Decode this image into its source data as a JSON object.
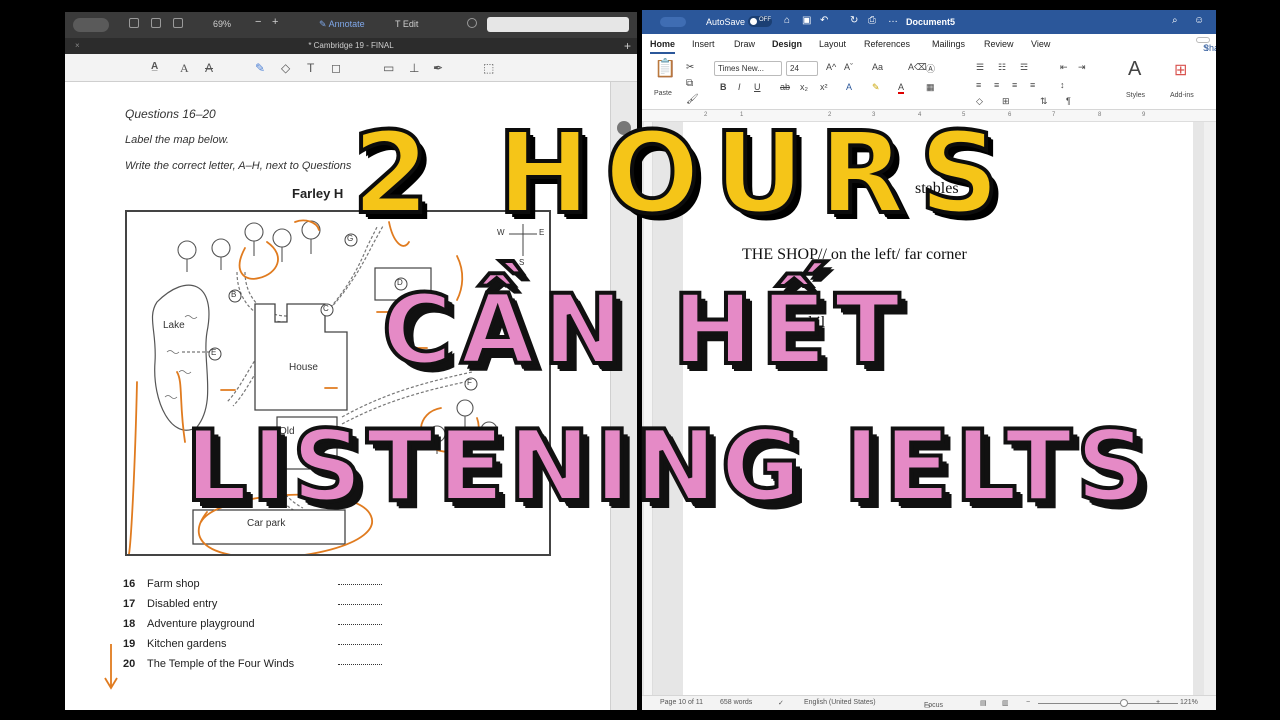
{
  "pdf_viewer": {
    "zoom": "69%",
    "annotate_label": "Annotate",
    "edit_label": "Edit",
    "document_tab": "* Cambridge 19 - FINAL",
    "close_tab": "×",
    "new_tab": "+"
  },
  "pdf_page": {
    "questions_title": "Questions 16–20",
    "instruction_1": "Label the map below.",
    "instruction_2": "Write the correct letter, A–H, next to Questions",
    "map_title": "Farley H",
    "map_labels": {
      "lake": "Lake",
      "house": "House",
      "car_park": "Car park",
      "old": "Old",
      "b": "B",
      "c": "C",
      "d": "D",
      "e": "E",
      "f": "F",
      "g": "G",
      "compass_w": "W",
      "compass_e": "E",
      "compass_s": "S"
    },
    "answers": [
      {
        "num": "16",
        "label": "Farm shop"
      },
      {
        "num": "17",
        "label": "Disabled entry"
      },
      {
        "num": "18",
        "label": "Adventure playground"
      },
      {
        "num": "19",
        "label": "Kitchen gardens"
      },
      {
        "num": "20",
        "label": "The Temple of the Four Winds"
      }
    ]
  },
  "word": {
    "autosave_label": "AutoSave",
    "autosave_state": "OFF",
    "document_title": "Document5",
    "tabs": [
      "Home",
      "Insert",
      "Draw",
      "Design",
      "Layout",
      "References",
      "Mailings",
      "Review",
      "View"
    ],
    "active_tab": "Home",
    "share_label": "Share",
    "font_name": "Times New...",
    "font_size": "24",
    "paste_label": "Paste",
    "styles_label": "Styles",
    "addins_label": "Add-ins",
    "doc_lines": {
      "line1_fragment": "stables",
      "line2": "THE SHOP// on the left/ far corner",
      "line3_fragment": "s chil"
    },
    "status": {
      "page": "Page 10 of 11",
      "words": "658 words",
      "language": "English (United States)",
      "focus": "Focus",
      "zoom": "121%"
    }
  },
  "overlay": {
    "line1": "2 HOURS",
    "line2": "CẦN HẾT",
    "line3": "LISTENING IELTS"
  }
}
